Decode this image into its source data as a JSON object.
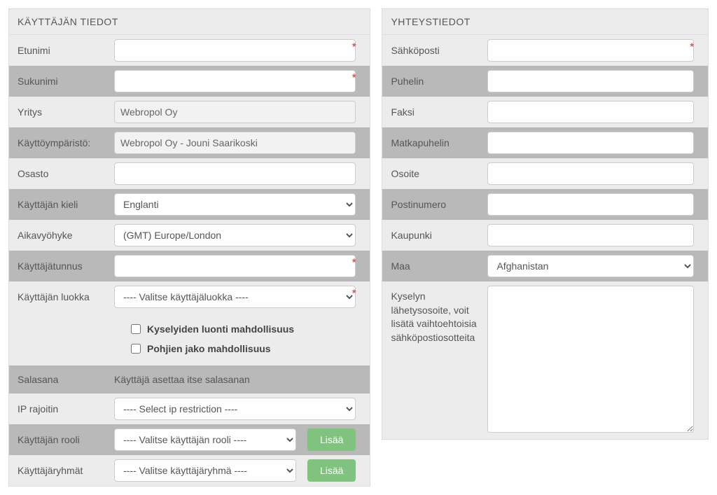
{
  "left": {
    "title": "KÄYTTÄJÄN TIEDOT",
    "firstName": "Etunimi",
    "lastName": "Sukunimi",
    "company": "Yritys",
    "companyValue": "Webropol Oy",
    "env": "Käyttöympäristö:",
    "envValue": "Webropol Oy - Jouni Saarikoski",
    "dept": "Osasto",
    "lang": "Käyttäjän kieli",
    "langValue": "Englanti",
    "tz": "Aikavyöhyke",
    "tzValue": "(GMT) Europe/London",
    "username": "Käyttäjätunnus",
    "userClass": "Käyttäjän luokka",
    "userClassValue": "---- Valitse käyttäjäluokka ----",
    "chk1": "Kyselyiden luonti mahdollisuus",
    "chk2": "Pohjien jako mahdollisuus",
    "password": "Salasana",
    "passwordText": "Käyttäjä asettaa itse salasanan",
    "iprestrict": "IP rajoitin",
    "iprestrictValue": "---- Select ip restriction ----",
    "role": "Käyttäjän rooli",
    "roleValue": "---- Valitse käyttäjän rooli ----",
    "groups": "Käyttäjäryhmät",
    "groupsValue": "---- Valitse käyttäjäryhmä ----",
    "addBtn": "Lisää"
  },
  "right": {
    "title": "YHTEYSTIEDOT",
    "email": "Sähköposti",
    "phone": "Puhelin",
    "fax": "Faksi",
    "mobile": "Matkapuhelin",
    "address": "Osoite",
    "postal": "Postinumero",
    "city": "Kaupunki",
    "country": "Maa",
    "countryValue": "Afghanistan",
    "surveyAddr": "Kyselyn lähetysosoite, voit lisätä vaihtoehtoisia sähköpostiosotteita"
  }
}
